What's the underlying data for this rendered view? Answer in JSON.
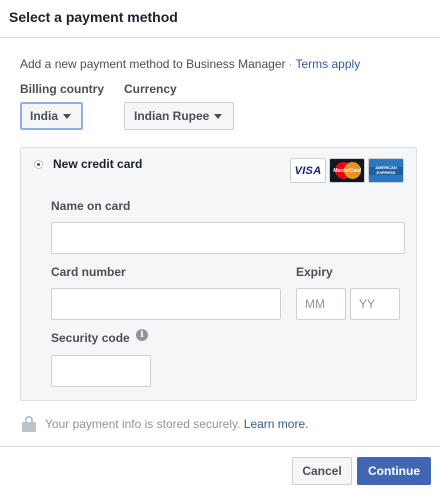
{
  "dialog": {
    "title": "Select a payment method"
  },
  "intro": {
    "text": "Add a new payment method to Business Manager",
    "separator": "·",
    "terms_link": "Terms apply"
  },
  "billing_country": {
    "label": "Billing country",
    "value": "India"
  },
  "currency": {
    "label": "Currency",
    "value": "Indian Rupee"
  },
  "credit_card": {
    "option_label": "New credit card",
    "logos": [
      {
        "name": "visa-logo",
        "text": "VISA"
      },
      {
        "name": "mastercard-logo",
        "text": "MasterCard"
      },
      {
        "name": "amex-logo",
        "text": "AMERICAN EXPRESS"
      }
    ],
    "name_label": "Name on card",
    "name_value": "",
    "number_label": "Card number",
    "number_value": "",
    "expiry_label": "Expiry",
    "expiry_month_placeholder": "MM",
    "expiry_year_placeholder": "YY",
    "security_label": "Security code",
    "security_value": "",
    "info_glyph": "i"
  },
  "secure_note": {
    "text": "Your payment info is stored securely.",
    "link": "Learn more."
  },
  "footer": {
    "cancel_label": "Cancel",
    "continue_label": "Continue"
  },
  "colors": {
    "primary": "#4267b2",
    "link": "#365899",
    "panel_bg": "#f5f6f7",
    "border": "#dddfe2"
  }
}
